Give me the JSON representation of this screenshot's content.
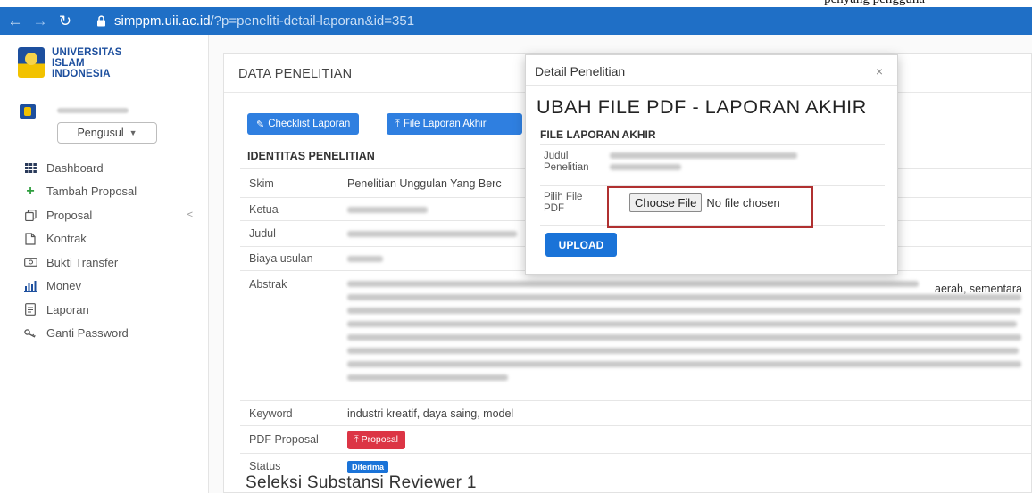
{
  "top_caption": "penyang pengguna",
  "browser": {
    "url_host": "simppm.uii.ac.id",
    "url_path": "/?p=peneliti-detail-laporan&id=351"
  },
  "sidebar": {
    "logo_lines": [
      "UNIVERSITAS",
      "ISLAM",
      "INDONESIA"
    ],
    "role": "Pengusul",
    "items": [
      {
        "label": "Dashboard",
        "icon": "grid-icon"
      },
      {
        "label": "Tambah Proposal",
        "icon": "plus-icon"
      },
      {
        "label": "Proposal",
        "icon": "copy-icon",
        "chevron": "<"
      },
      {
        "label": "Kontrak",
        "icon": "file-icon"
      },
      {
        "label": "Bukti Transfer",
        "icon": "money-icon"
      },
      {
        "label": "Monev",
        "icon": "bar-chart-icon"
      },
      {
        "label": "Laporan",
        "icon": "document-icon"
      },
      {
        "label": "Ganti Password",
        "icon": "key-icon"
      }
    ]
  },
  "main": {
    "card_title": "DATA PENELITIAN",
    "buttons": {
      "checklist": "Checklist Laporan",
      "file_laporan": "File Laporan Akhir"
    },
    "identitas_title": "IDENTITAS PENELITIAN",
    "rows": {
      "skim_label": "Skim",
      "skim_value": "Penelitian Unggulan Yang Berc",
      "ketua_label": "Ketua",
      "judul_label": "Judul",
      "biaya_label": "Biaya usulan",
      "abstrak_label": "Abstrak",
      "abstrak_visible_fragment": "aerah, sementara",
      "keyword_label": "Keyword",
      "keyword_value": "industri kreatif, daya saing, model",
      "pdf_label": "PDF Proposal",
      "pdf_button": "Proposal",
      "status_label": "Status",
      "status_value": "Diterima"
    },
    "seleksi_title": "Seleksi Substansi Reviewer 1"
  },
  "modal": {
    "title": "Detail Penelitian",
    "close": "×",
    "heading": "UBAH FILE PDF - LAPORAN AKHIR",
    "subheading": "FILE LAPORAN AKHIR",
    "judul_label": "Judul Penelitian",
    "pilih_label": "Pilih File PDF",
    "choose_file": "Choose File",
    "no_file": "No file chosen",
    "upload": "UPLOAD"
  },
  "colors": {
    "browser_bar": "#1f6fc6",
    "primary": "#2f7fe0",
    "danger": "#dc3545",
    "highlight_box": "#b03030"
  }
}
